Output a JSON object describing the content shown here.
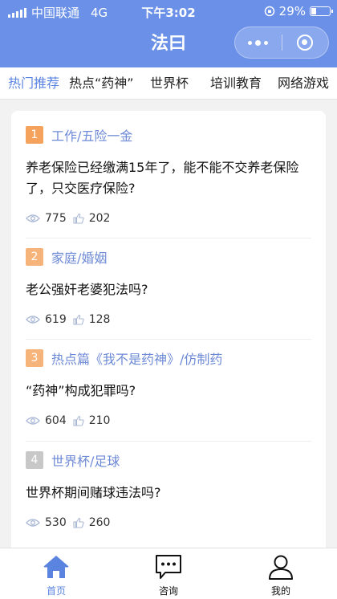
{
  "status": {
    "carrier": "中国联通",
    "network": "4G",
    "time": "下午3:02",
    "battery": "29%"
  },
  "navbar": {
    "title": "法曰"
  },
  "tabs": [
    {
      "label": "热门推荐",
      "active": true
    },
    {
      "label": "热点“药神”",
      "active": false
    },
    {
      "label": "世界杯",
      "active": false
    },
    {
      "label": "培训教育",
      "active": false
    },
    {
      "label": "网络游戏",
      "active": false
    }
  ],
  "questions": [
    {
      "rank": "1",
      "rank_color": "#f5a25d",
      "category": "工作/五险一金",
      "question": "养老保险已经缴满15年了，能不能不交养老保险了，只交医疗保险?",
      "views": "775",
      "likes": "202"
    },
    {
      "rank": "2",
      "rank_color": "#f7b47a",
      "category": "家庭/婚姻",
      "question": "老公强奸老婆犯法吗?",
      "views": "619",
      "likes": "128"
    },
    {
      "rank": "3",
      "rank_color": "#f7b47a",
      "category": "热点篇《我不是药神》/仿制药",
      "question": "“药神”构成犯罪吗?",
      "views": "604",
      "likes": "210"
    },
    {
      "rank": "4",
      "rank_color": "#c8c8c8",
      "category": "世界杯/足球",
      "question": "世界杯期间赌球违法吗?",
      "views": "530",
      "likes": "260"
    }
  ],
  "tabbar": [
    {
      "label": "首页",
      "icon": "home-icon",
      "active": true
    },
    {
      "label": "咨询",
      "icon": "chat-icon",
      "active": false
    },
    {
      "label": "我的",
      "icon": "user-icon",
      "active": false
    }
  ],
  "colors": {
    "brand": "#6a90e8",
    "accent": "#5b84e0",
    "category_text": "#6d8ad6"
  }
}
